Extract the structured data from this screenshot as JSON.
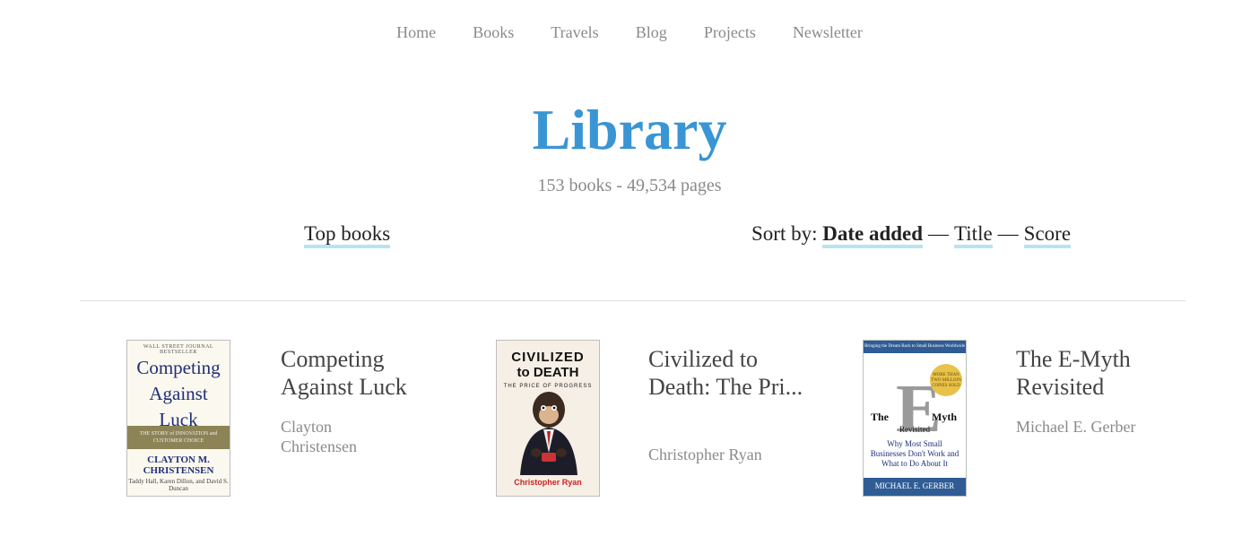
{
  "nav": {
    "items": [
      "Home",
      "Books",
      "Travels",
      "Blog",
      "Projects",
      "Newsletter"
    ]
  },
  "header": {
    "title": "Library",
    "stats": "153 books - 49,534 pages"
  },
  "filters": {
    "top_books": "Top books",
    "sort_label": "Sort by:",
    "sort_options": [
      "Date added",
      "Title",
      "Score"
    ],
    "separator": "—",
    "active_sort": "Date added"
  },
  "books": [
    {
      "title": "Competing Against Luck",
      "author": "Clayton Christensen",
      "cover": {
        "kicker": "WALL STREET JOURNAL BESTSELLER",
        "title_lines": [
          "Competing",
          "Against",
          "Luck"
        ],
        "band": "THE STORY of INNOVATION and CUSTOMER CHOICE",
        "author_lines": [
          "CLAYTON M.",
          "CHRISTENSEN"
        ],
        "coauthors": "Taddy Hall, Karen Dillon, and David S. Duncan"
      }
    },
    {
      "title": "Civilized to Death: The Pri...",
      "author": "Christopher Ryan",
      "cover": {
        "title_line1": "CIVILIZED",
        "title_line2": "to DEATH",
        "subtitle": "THE PRICE OF PROGRESS",
        "author": "Christopher Ryan"
      }
    },
    {
      "title": "The E-Myth Revisited",
      "author": "Michael E. Gerber",
      "cover": {
        "kicker": "Bringing the Dream Back to Small Business Worldwide",
        "seal": "MORE THAN TWO MILLION COPIES SOLD",
        "the": "The",
        "letter": "E",
        "myth": "Myth",
        "revisited": "Revisited",
        "subtitle": "Why Most Small Businesses Don't Work and What to Do About It",
        "author": "MICHAEL E. GERBER"
      }
    }
  ],
  "colors": {
    "accent": "#3a95d4",
    "underline": "#b9e3f2",
    "muted": "#8a8a8a"
  }
}
